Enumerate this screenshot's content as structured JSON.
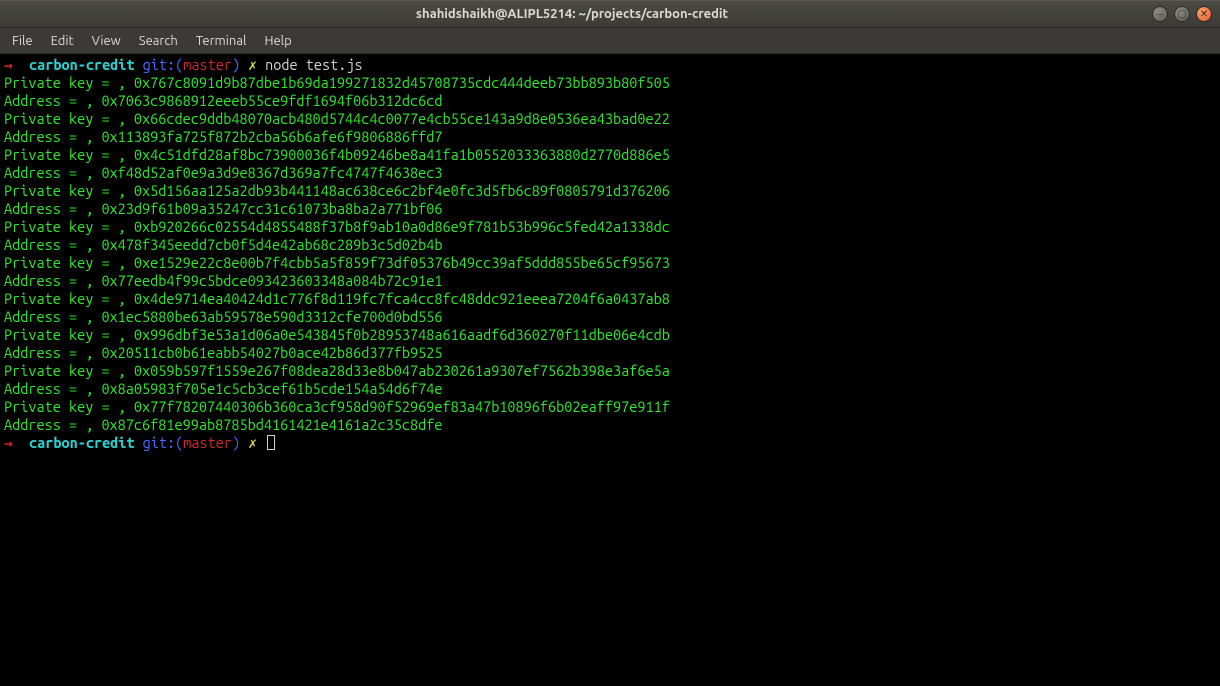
{
  "window": {
    "title": "shahidshaikh@ALIPL5214: ~/projects/carbon-credit"
  },
  "menu": {
    "file": "File",
    "edit": "Edit",
    "view": "View",
    "search": "Search",
    "terminal": "Terminal",
    "help": "Help"
  },
  "prompt": {
    "arrow": "→",
    "dir": "carbon-credit",
    "git": "git:(",
    "branch": "master",
    "git_close": ")",
    "x": "✗"
  },
  "first_cmd": "node test.js",
  "output": [
    "Private key = , 0x767c8091d9b87dbe1b69da199271832d45708735cdc444deeb73bb893b80f505",
    "Address = , 0x7063c9868912eeeb55ce9fdf1694f06b312dc6cd",
    "Private key = , 0x66cdec9ddb48070acb480d5744c4c0077e4cb55ce143a9d8e0536ea43bad0e22",
    "Address = , 0x113893fa725f872b2cba56b6afe6f9806886ffd7",
    "Private key = , 0x4c51dfd28af8bc73900036f4b09246be8a41fa1b0552033363880d2770d886e5",
    "Address = , 0xf48d52af0e9a3d9e8367d369a7fc4747f4638ec3",
    "Private key = , 0x5d156aa125a2db93b441148ac638ce6c2bf4e0fc3d5fb6c89f0805791d376206",
    "Address = , 0x23d9f61b09a35247cc31c61073ba8ba2a771bf06",
    "Private key = , 0xb920266c02554d4855488f37b8f9ab10a0d86e9f781b53b996c5fed42a1338dc",
    "Address = , 0x478f345eedd7cb0f5d4e42ab68c289b3c5d02b4b",
    "Private key = , 0xe1529e22c8e00b7f4cbb5a5f859f73df05376b49cc39af5ddd855be65cf95673",
    "Address = , 0x77eedb4f99c5bdce093423603348a084b72c91e1",
    "Private key = , 0x4de9714ea40424d1c776f8d119fc7fca4cc8fc48ddc921eeea7204f6a0437ab8",
    "Address = , 0x1ec5880be63ab59578e590d3312cfe700d0bd556",
    "Private key = , 0x996dbf3e53a1d06a0e543845f0b28953748a616aadf6d360270f11dbe06e4cdb",
    "Address = , 0x20511cb0b61eabb54027b0ace42b86d377fb9525",
    "Private key = , 0x059b597f1559e267f08dea28d33e8b047ab230261a9307ef7562b398e3af6e5a",
    "Address = , 0x8a05983f705e1c5cb3cef61b5cde154a54d6f74e",
    "Private key = , 0x77f78207440306b360ca3cf958d90f52969ef83a47b10896f6b02eaff97e911f",
    "Address = , 0x87c6f81e99ab8785bd4161421e4161a2c35c8dfe"
  ]
}
